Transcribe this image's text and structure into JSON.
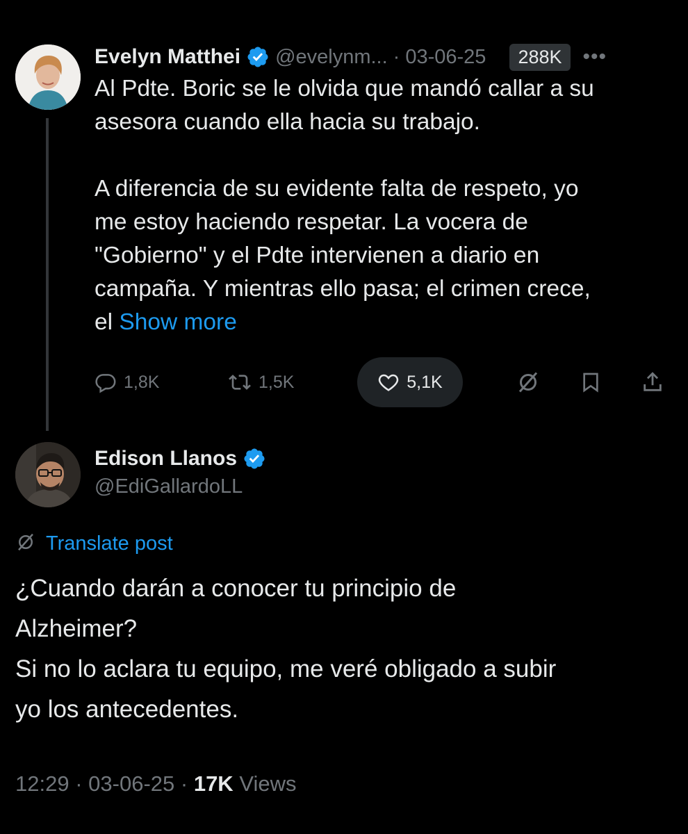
{
  "colors": {
    "background": "#000000",
    "text_primary": "#e7e9ea",
    "text_secondary": "#71767b",
    "link": "#1d9bf0",
    "verified": "#1d9bf0",
    "chip": "#2f3336"
  },
  "parent_post": {
    "author_name": "Evelyn Matthei",
    "handle": "@evelynm...",
    "separator": "·",
    "date": "03-06-25",
    "views_badge": "288K",
    "more_icon": "more-horizontal-icon",
    "verified_icon": "verified-badge-icon",
    "text_lines_1": [
      "Al Pdte. Boric se le olvida que mandó callar a su",
      "asesora cuando ella hacia su trabajo."
    ],
    "text_lines_2": [
      "A diferencia de su evidente falta de respeto, yo",
      "me estoy haciendo respetar. La vocera de",
      "\"Gobierno\" y el Pdte intervienen a diario en",
      "campaña. Y mientras ello pasa; el crimen crece,"
    ],
    "text_last_prefix": "el ",
    "show_more": "Show more",
    "actions": {
      "reply_count": "1,8K",
      "retweet_count": "1,5K",
      "like_count": "5,1K",
      "reply_icon": "reply-icon",
      "retweet_icon": "retweet-icon",
      "like_icon": "heart-icon",
      "grok_icon": "grok-icon",
      "bookmark_icon": "bookmark-icon",
      "share_icon": "share-icon"
    }
  },
  "reply_post": {
    "author_name": "Edison Llanos",
    "handle": "@EdiGallardoLL",
    "translate_label": "Translate post",
    "translate_icon": "grok-icon",
    "text_lines": [
      "¿Cuando darán a conocer tu principio de",
      "Alzheimer?",
      "Si no lo aclara tu equipo, me veré obligado a subir",
      "yo los antecedentes."
    ],
    "time": "12:29",
    "date": "03-06-25",
    "views_count": "17K",
    "views_label": "Views",
    "separator": "·"
  }
}
